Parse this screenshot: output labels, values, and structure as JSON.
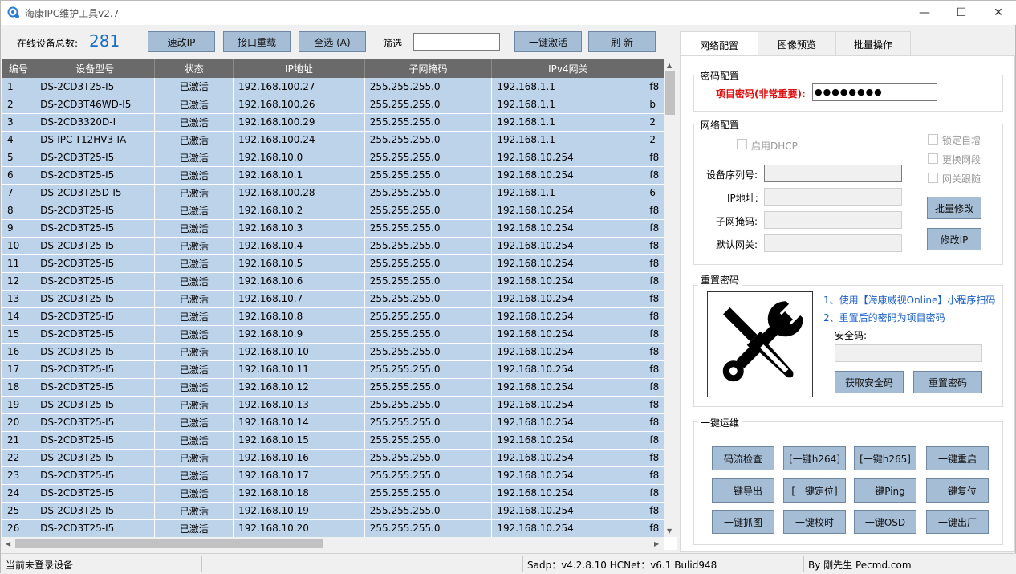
{
  "window": {
    "title": "海康IPC维护工具v2.7",
    "minimize": "—",
    "maximize": "☐",
    "close": "✕"
  },
  "toolbar": {
    "count_label": "在线设备总数:",
    "count": "281",
    "btn_fast_ip": "速改IP",
    "btn_reload": "接口重载",
    "btn_select_all": "全选 (A)",
    "filter_label": "筛选",
    "filter_value": "",
    "btn_activate": "一键激活",
    "btn_refresh": "刷  新"
  },
  "grid": {
    "columns": [
      "编号",
      "设备型号",
      "状态",
      "IP地址",
      "子网掩码",
      "IPv4网关"
    ],
    "rows": [
      [
        "1",
        "DS-2CD3T25-I5",
        "已激活",
        "192.168.100.27",
        "255.255.255.0",
        "192.168.1.1",
        "f8"
      ],
      [
        "2",
        "DS-2CD3T46WD-I5",
        "已激活",
        "192.168.100.26",
        "255.255.255.0",
        "192.168.1.1",
        "b"
      ],
      [
        "3",
        "DS-2CD3320D-I",
        "已激活",
        "192.168.100.29",
        "255.255.255.0",
        "192.168.1.1",
        "2"
      ],
      [
        "4",
        "DS-IPC-T12HV3-IA",
        "已激活",
        "192.168.100.24",
        "255.255.255.0",
        "192.168.1.1",
        "2"
      ],
      [
        "5",
        "DS-2CD3T25-I5",
        "已激活",
        "192.168.10.0",
        "255.255.255.0",
        "192.168.10.254",
        "f8"
      ],
      [
        "6",
        "DS-2CD3T25-I5",
        "已激活",
        "192.168.10.1",
        "255.255.255.0",
        "192.168.10.254",
        "f8"
      ],
      [
        "7",
        "DS-2CD3T25D-I5",
        "已激活",
        "192.168.100.28",
        "255.255.255.0",
        "192.168.1.1",
        "6"
      ],
      [
        "8",
        "DS-2CD3T25-I5",
        "已激活",
        "192.168.10.2",
        "255.255.255.0",
        "192.168.10.254",
        "f8"
      ],
      [
        "9",
        "DS-2CD3T25-I5",
        "已激活",
        "192.168.10.3",
        "255.255.255.0",
        "192.168.10.254",
        "f8"
      ],
      [
        "10",
        "DS-2CD3T25-I5",
        "已激活",
        "192.168.10.4",
        "255.255.255.0",
        "192.168.10.254",
        "f8"
      ],
      [
        "11",
        "DS-2CD3T25-I5",
        "已激活",
        "192.168.10.5",
        "255.255.255.0",
        "192.168.10.254",
        "f8"
      ],
      [
        "12",
        "DS-2CD3T25-I5",
        "已激活",
        "192.168.10.6",
        "255.255.255.0",
        "192.168.10.254",
        "f8"
      ],
      [
        "13",
        "DS-2CD3T25-I5",
        "已激活",
        "192.168.10.7",
        "255.255.255.0",
        "192.168.10.254",
        "f8"
      ],
      [
        "14",
        "DS-2CD3T25-I5",
        "已激活",
        "192.168.10.8",
        "255.255.255.0",
        "192.168.10.254",
        "f8"
      ],
      [
        "15",
        "DS-2CD3T25-I5",
        "已激活",
        "192.168.10.9",
        "255.255.255.0",
        "192.168.10.254",
        "f8"
      ],
      [
        "16",
        "DS-2CD3T25-I5",
        "已激活",
        "192.168.10.10",
        "255.255.255.0",
        "192.168.10.254",
        "f8"
      ],
      [
        "17",
        "DS-2CD3T25-I5",
        "已激活",
        "192.168.10.11",
        "255.255.255.0",
        "192.168.10.254",
        "f8"
      ],
      [
        "18",
        "DS-2CD3T25-I5",
        "已激活",
        "192.168.10.12",
        "255.255.255.0",
        "192.168.10.254",
        "f8"
      ],
      [
        "19",
        "DS-2CD3T25-I5",
        "已激活",
        "192.168.10.13",
        "255.255.255.0",
        "192.168.10.254",
        "f8"
      ],
      [
        "20",
        "DS-2CD3T25-I5",
        "已激活",
        "192.168.10.14",
        "255.255.255.0",
        "192.168.10.254",
        "f8"
      ],
      [
        "21",
        "DS-2CD3T25-I5",
        "已激活",
        "192.168.10.15",
        "255.255.255.0",
        "192.168.10.254",
        "f8"
      ],
      [
        "22",
        "DS-2CD3T25-I5",
        "已激活",
        "192.168.10.16",
        "255.255.255.0",
        "192.168.10.254",
        "f8"
      ],
      [
        "23",
        "DS-2CD3T25-I5",
        "已激活",
        "192.168.10.17",
        "255.255.255.0",
        "192.168.10.254",
        "f8"
      ],
      [
        "24",
        "DS-2CD3T25-I5",
        "已激活",
        "192.168.10.18",
        "255.255.255.0",
        "192.168.10.254",
        "f8"
      ],
      [
        "25",
        "DS-2CD3T25-I5",
        "已激活",
        "192.168.10.19",
        "255.255.255.0",
        "192.168.10.254",
        "f8"
      ],
      [
        "26",
        "DS-2CD3T25-I5",
        "已激活",
        "192.168.10.20",
        "255.255.255.0",
        "192.168.10.254",
        "f8"
      ]
    ]
  },
  "tabs": [
    "网络配置",
    "图像预览",
    "批量操作"
  ],
  "password": {
    "group": "密码配置",
    "label": "项目密码(非常重要):",
    "value": "●●●●●●●●"
  },
  "network": {
    "group": "网络配置",
    "dhcp": "启用DHCP",
    "lock_inc": "锁定自增",
    "change_seg": "更换网段",
    "gw_follow": "网关跟随",
    "serial_label": "设备序列号:",
    "ip_label": "IP地址:",
    "mask_label": "子网掩码:",
    "gw_label": "默认网关:",
    "btn_batch": "批量修改",
    "btn_modify_ip": "修改IP"
  },
  "reset": {
    "group": "重置密码",
    "tip1": "1、使用【海康威视Online】小程序扫码",
    "tip2": "2、重置后的密码为项目密码",
    "code_label": "安全码:",
    "btn_get_code": "获取安全码",
    "btn_reset": "重置密码"
  },
  "ops": {
    "group": "一键运维",
    "buttons": [
      "码流检查",
      "[一键h264]",
      "[一键h265]",
      "一键重启",
      "一键导出",
      "[一键定位]",
      "一键Ping",
      "一键复位",
      "一键抓图",
      "一键校时",
      "一键OSD",
      "一键出厂"
    ]
  },
  "statusbar": {
    "login": "当前未登录设备",
    "version": "Sadp：v4.2.8.10  HCNet：v6.1 Bulid948",
    "author": "By 刚先生 Pecmd.com"
  }
}
